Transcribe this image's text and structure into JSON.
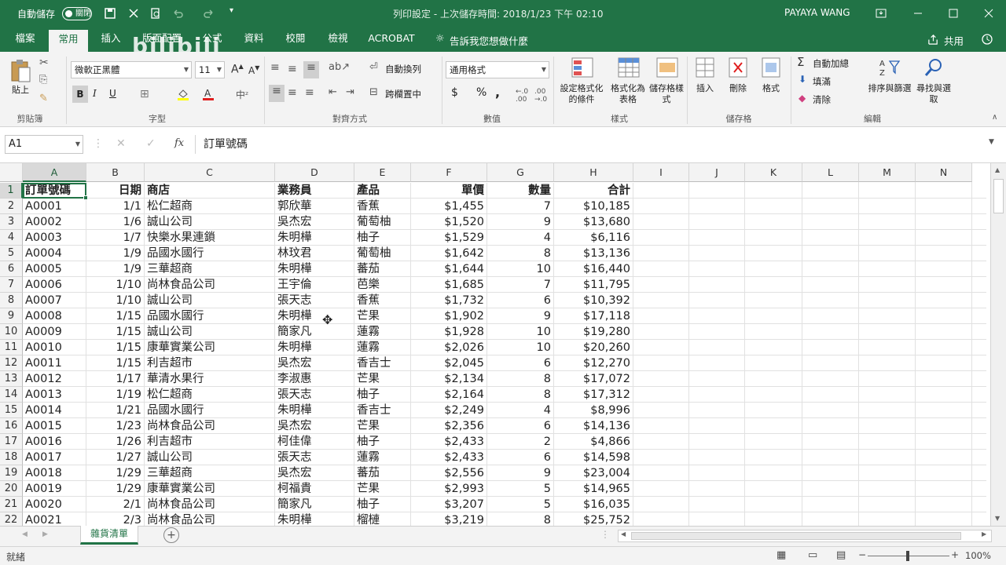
{
  "titlebar": {
    "autosave_label": "自動儲存",
    "autosave_state": "關閉",
    "doc_title": "列印設定 - 上次儲存時間: 2018/1/23 下午 02:10",
    "user": "PAYAYA WANG",
    "watermark": "bilibili"
  },
  "tabs": {
    "items": [
      "檔案",
      "常用",
      "插入",
      "版面配置",
      "公式",
      "資料",
      "校閱",
      "檢視",
      "ACROBAT"
    ],
    "tell_me": "告訴我您想做什麼",
    "share": "共用"
  },
  "ribbon": {
    "clipboard": {
      "paste": "貼上",
      "label": "剪貼簿"
    },
    "font": {
      "name": "微軟正黑體",
      "size": "11",
      "bold": "B",
      "italic": "I",
      "underline": "U",
      "label": "字型"
    },
    "alignment": {
      "wrap": "自動換列",
      "merge": "跨欄置中",
      "label": "對齊方式"
    },
    "number": {
      "format": "通用格式",
      "currency": "$",
      "percent": "%",
      "comma": ",",
      "label": "數值"
    },
    "styles": {
      "conditional": "設定格式化的條件",
      "table": "格式化為表格",
      "cell": "儲存格樣式",
      "label": "樣式"
    },
    "cells": {
      "insert": "插入",
      "delete": "刪除",
      "format": "格式",
      "label": "儲存格"
    },
    "editing": {
      "autosum": "自動加總",
      "fill": "填滿",
      "clear": "清除",
      "sort": "排序與篩選",
      "find": "尋找與選取",
      "label": "編輯"
    }
  },
  "formula": {
    "name_box": "A1",
    "fx": "fx",
    "content": "訂單號碼"
  },
  "sheet": {
    "col_letters": [
      "A",
      "B",
      "C",
      "D",
      "E",
      "F",
      "G",
      "H",
      "I",
      "J",
      "K",
      "L",
      "M",
      "N"
    ],
    "headers": [
      "訂單號碼",
      "日期",
      "商店",
      "業務員",
      "產品",
      "單價",
      "數量",
      "合計"
    ],
    "rows": [
      [
        "A0001",
        "1/1",
        "松仁超商",
        "郭欣華",
        "香蕉",
        "$1,455",
        "7",
        "$10,185"
      ],
      [
        "A0002",
        "1/6",
        "誠山公司",
        "吳杰宏",
        "葡萄柚",
        "$1,520",
        "9",
        "$13,680"
      ],
      [
        "A0003",
        "1/7",
        "快樂水果連鎖",
        "朱明樺",
        "柚子",
        "$1,529",
        "4",
        "$6,116"
      ],
      [
        "A0004",
        "1/9",
        "品國水國行",
        "林玟君",
        "葡萄柚",
        "$1,642",
        "8",
        "$13,136"
      ],
      [
        "A0005",
        "1/9",
        "三華超商",
        "朱明樺",
        "蕃茄",
        "$1,644",
        "10",
        "$16,440"
      ],
      [
        "A0006",
        "1/10",
        "尚林食品公司",
        "王宇倫",
        "芭樂",
        "$1,685",
        "7",
        "$11,795"
      ],
      [
        "A0007",
        "1/10",
        "誠山公司",
        "張天志",
        "香蕉",
        "$1,732",
        "6",
        "$10,392"
      ],
      [
        "A0008",
        "1/15",
        "品國水國行",
        "朱明樺",
        "芒果",
        "$1,902",
        "9",
        "$17,118"
      ],
      [
        "A0009",
        "1/15",
        "誠山公司",
        "簡家凡",
        "蓮霧",
        "$1,928",
        "10",
        "$19,280"
      ],
      [
        "A0010",
        "1/15",
        "康華實業公司",
        "朱明樺",
        "蓮霧",
        "$2,026",
        "10",
        "$20,260"
      ],
      [
        "A0011",
        "1/15",
        "利吉超市",
        "吳杰宏",
        "香吉士",
        "$2,045",
        "6",
        "$12,270"
      ],
      [
        "A0012",
        "1/17",
        "華清水果行",
        "李淑惠",
        "芒果",
        "$2,134",
        "8",
        "$17,072"
      ],
      [
        "A0013",
        "1/19",
        "松仁超商",
        "張天志",
        "柚子",
        "$2,164",
        "8",
        "$17,312"
      ],
      [
        "A0014",
        "1/21",
        "品國水國行",
        "朱明樺",
        "香吉士",
        "$2,249",
        "4",
        "$8,996"
      ],
      [
        "A0015",
        "1/23",
        "尚林食品公司",
        "吳杰宏",
        "芒果",
        "$2,356",
        "6",
        "$14,136"
      ],
      [
        "A0016",
        "1/26",
        "利吉超市",
        "柯佳偉",
        "柚子",
        "$2,433",
        "2",
        "$4,866"
      ],
      [
        "A0017",
        "1/27",
        "誠山公司",
        "張天志",
        "蓮霧",
        "$2,433",
        "6",
        "$14,598"
      ],
      [
        "A0018",
        "1/29",
        "三華超商",
        "吳杰宏",
        "蕃茄",
        "$2,556",
        "9",
        "$23,004"
      ],
      [
        "A0019",
        "1/29",
        "康華實業公司",
        "柯福貴",
        "芒果",
        "$2,993",
        "5",
        "$14,965"
      ],
      [
        "A0020",
        "2/1",
        "尚林食品公司",
        "簡家凡",
        "柚子",
        "$3,207",
        "5",
        "$16,035"
      ],
      [
        "A0021",
        "2/3",
        "尚林食品公司",
        "朱明樺",
        "榴槤",
        "$3,219",
        "8",
        "$25,752"
      ]
    ]
  },
  "sheet_tab": {
    "name": "雜貨清單"
  },
  "status": {
    "mode": "就緒",
    "zoom": "100%"
  }
}
